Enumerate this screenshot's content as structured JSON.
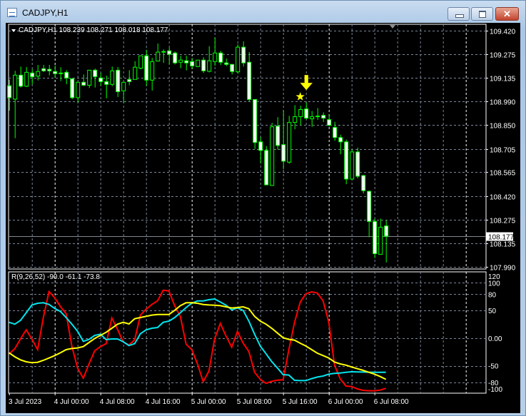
{
  "window": {
    "title": "CADJPY,H1",
    "buttons": {
      "minimize": "minimize",
      "maximize": "maximize",
      "close": "close"
    }
  },
  "colors": {
    "background": "#000000",
    "candle_outline": "#00ff00",
    "bear_body": "#ffffff",
    "bull_body": "#000000",
    "grid": "#7a8799",
    "day_separator": "#ffffff",
    "axis_text": "#ffffff",
    "price_line": "#808890",
    "marker": "#ffff00"
  },
  "chart_data": [
    {
      "type": "candlestick",
      "title": "CADJPY,H1",
      "info": "CADJPY,H1  108.239 108.271 108.018 108.177",
      "ohlc_order": [
        "open",
        "high",
        "low",
        "close"
      ],
      "candles": [
        [
          109.086,
          109.122,
          108.935,
          109.014
        ],
        [
          109.005,
          109.176,
          108.769,
          109.15
        ],
        [
          109.15,
          109.202,
          109.075,
          109.083
        ],
        [
          109.083,
          109.199,
          109.078,
          109.167
        ],
        [
          109.163,
          109.187,
          109.094,
          109.14
        ],
        [
          109.144,
          109.212,
          109.118,
          109.172
        ],
        [
          109.189,
          109.212,
          109.169,
          109.176
        ],
        [
          109.185,
          109.212,
          109.148,
          109.176
        ],
        [
          109.172,
          109.208,
          109.135,
          109.159
        ],
        [
          109.163,
          109.198,
          109.114,
          109.162
        ],
        [
          109.167,
          109.18,
          109.095,
          109.133
        ],
        [
          109.128,
          109.133,
          109.005,
          109.014
        ],
        [
          109.014,
          109.107,
          108.985,
          109.107
        ],
        [
          109.107,
          109.154,
          109.083,
          109.089
        ],
        [
          109.089,
          109.18,
          109.072,
          109.18
        ],
        [
          109.18,
          109.19,
          109.075,
          109.141
        ],
        [
          109.133,
          109.164,
          109.086,
          109.111
        ],
        [
          109.111,
          109.147,
          109.01,
          109.094
        ],
        [
          109.094,
          109.202,
          109.083,
          109.176
        ],
        [
          109.18,
          109.199,
          109.018,
          109.05
        ],
        [
          109.055,
          109.107,
          108.981,
          109.107
        ],
        [
          109.124,
          109.18,
          109.089,
          109.111
        ],
        [
          109.124,
          109.234,
          109.124,
          109.198
        ],
        [
          109.192,
          109.267,
          109.185,
          109.267
        ],
        [
          109.267,
          109.303,
          109.085,
          109.12
        ],
        [
          109.12,
          109.254,
          109.057,
          109.232
        ],
        [
          109.235,
          109.341,
          109.235,
          109.289
        ],
        [
          109.292,
          109.306,
          109.224,
          109.293
        ],
        [
          109.297,
          109.315,
          109.216,
          109.276
        ],
        [
          109.284,
          109.293,
          109.215,
          109.224
        ],
        [
          109.228,
          109.267,
          109.192,
          109.241
        ],
        [
          109.237,
          109.267,
          109.179,
          109.224
        ],
        [
          109.232,
          109.254,
          109.189,
          109.206
        ],
        [
          109.202,
          109.241,
          109.198,
          109.241
        ],
        [
          109.241,
          109.258,
          109.163,
          109.176
        ],
        [
          109.173,
          109.325,
          109.167,
          109.237
        ],
        [
          109.232,
          109.377,
          109.206,
          109.284
        ],
        [
          109.284,
          109.297,
          109.211,
          109.228
        ],
        [
          109.224,
          109.25,
          109.205,
          109.215
        ],
        [
          109.215,
          109.215,
          109.154,
          109.172
        ],
        [
          109.17,
          109.336,
          109.159,
          109.319
        ],
        [
          109.319,
          109.354,
          109.202,
          109.224
        ],
        [
          109.228,
          109.289,
          108.99,
          109.003
        ],
        [
          109.003,
          109.003,
          108.704,
          108.743
        ],
        [
          108.747,
          108.776,
          108.617,
          108.695
        ],
        [
          108.695,
          108.721,
          108.487,
          108.487
        ],
        [
          108.483,
          108.862,
          108.483,
          108.838
        ],
        [
          108.842,
          108.896,
          108.699,
          108.725
        ],
        [
          108.73,
          108.938,
          108.581,
          108.63
        ],
        [
          108.624,
          108.904,
          108.615,
          108.864
        ],
        [
          108.864,
          108.969,
          108.823,
          108.899
        ],
        [
          108.899,
          108.965,
          108.847,
          108.942
        ],
        [
          108.946,
          108.985,
          108.884,
          108.89
        ],
        [
          108.886,
          108.933,
          108.838,
          108.899
        ],
        [
          108.902,
          108.951,
          108.88,
          108.903
        ],
        [
          108.907,
          108.925,
          108.867,
          108.89
        ],
        [
          108.881,
          108.912,
          108.841,
          108.847
        ],
        [
          108.834,
          108.868,
          108.754,
          108.773
        ],
        [
          108.773,
          108.79,
          108.672,
          108.747
        ],
        [
          108.747,
          108.76,
          108.491,
          108.522
        ],
        [
          108.522,
          108.699,
          108.517,
          108.686
        ],
        [
          108.686,
          108.712,
          108.526,
          108.539
        ],
        [
          108.543,
          108.548,
          108.435,
          108.452
        ],
        [
          108.448,
          108.452,
          108.171,
          108.266
        ],
        [
          108.266,
          108.283,
          108.045,
          108.071
        ],
        [
          108.067,
          108.283,
          108.067,
          108.231
        ],
        [
          108.239,
          108.271,
          108.018,
          108.177
        ]
      ],
      "current_price": "108.177",
      "y_ticks": [
        "109.420",
        "109.275",
        "109.135",
        "108.990",
        "108.850",
        "108.705",
        "108.565",
        "108.420",
        "108.275",
        "108.135",
        "107.990"
      ],
      "ylim": [
        107.99,
        109.42
      ],
      "markers": [
        {
          "type": "star",
          "bar": 51,
          "price": 109.02
        },
        {
          "type": "arrow-down",
          "bar": 52,
          "price": 109.06
        }
      ],
      "grid": true
    },
    {
      "type": "line",
      "title": "R(9,26,52)",
      "readout": [
        "-90.0",
        "-61.1",
        "-73.8"
      ],
      "y_ticks": [
        "120",
        "100",
        "80",
        "50",
        "0.00",
        "-50",
        "-80",
        "-100"
      ],
      "ylim": [
        -100,
        112
      ],
      "grid": true,
      "series": [
        {
          "color": "#ff0000",
          "values": [
            -28.2,
            -18.8,
            -1.3,
            15.0,
            -1.3,
            -20.5,
            37.2,
            83.8,
            72.6,
            56.8,
            44.0,
            -14.1,
            -53.8,
            -71.8,
            -46.2,
            -22.6,
            -15.0,
            -9.8,
            36.3,
            15.8,
            -6.4,
            -12.0,
            -3.0,
            41.5,
            52.1,
            60.7,
            67.1,
            86.3,
            85.0,
            58.5,
            39.3,
            -10.7,
            -20.5,
            -46.2,
            -78.2,
            -59.0,
            -1.3,
            26.5,
            3.8,
            -16.2,
            12.4,
            -9.0,
            -23.9,
            -61.1,
            -73.9,
            -81.2,
            -77.4,
            -75.2,
            -74.8,
            -20.5,
            28.6,
            65.0,
            80.0,
            83.3,
            81.2,
            67.1,
            28.6,
            -48.3,
            -73.1,
            -85.9,
            -86.8,
            -91.0,
            -93.6,
            -94.4,
            -94.4,
            -93.2,
            -90.0
          ]
        },
        {
          "color": "#00e5ee",
          "values": [
            28.6,
            25.2,
            32.1,
            45.7,
            59.8,
            62.8,
            63.7,
            60.7,
            53.4,
            47.9,
            37.2,
            25.2,
            12.4,
            -5.6,
            -2.1,
            5.1,
            7.3,
            -2.6,
            -1.3,
            -1.3,
            -6.4,
            -13.2,
            -9.8,
            8.1,
            15.0,
            17.9,
            19.2,
            28.6,
            30.8,
            37.2,
            45.7,
            55.1,
            62.8,
            67.1,
            67.1,
            69.2,
            70.5,
            65.0,
            59.4,
            50.9,
            54.3,
            50.0,
            30.8,
            7.3,
            -14.1,
            -27.8,
            -41.9,
            -53.4,
            -65.4,
            -66.2,
            -75.6,
            -76.1,
            -76.1,
            -72.6,
            -69.7,
            -67.9,
            -64.5,
            -63.2,
            -62.4,
            -61.1,
            -60.3,
            -60.5,
            -60.8,
            -61.0,
            -61.1,
            -61.1,
            -61.1
          ]
        },
        {
          "color": "#ffff00",
          "values": [
            -26.1,
            -33.3,
            -38.9,
            -42.3,
            -44.0,
            -43.2,
            -39.7,
            -35.5,
            -31.2,
            -26.1,
            -20.5,
            -18.4,
            -17.5,
            -15.0,
            -7.7,
            -0.4,
            5.1,
            10.7,
            17.9,
            25.2,
            28.6,
            25.6,
            35.0,
            37.2,
            39.3,
            41.5,
            42.7,
            42.7,
            42.7,
            50.0,
            58.5,
            63.7,
            63.7,
            62.8,
            60.7,
            59.8,
            59.4,
            58.5,
            56.4,
            54.3,
            55.1,
            56.4,
            53.0,
            39.3,
            30.8,
            25.2,
            17.9,
            9.4,
            0.9,
            -2.1,
            -3.4,
            -9.0,
            -14.1,
            -20.5,
            -26.9,
            -31.2,
            -35.5,
            -42.7,
            -46.2,
            -48.3,
            -51.7,
            -54.7,
            -57.7,
            -61.1,
            -64.5,
            -68.8,
            -73.8
          ]
        }
      ]
    }
  ],
  "x_axis": {
    "labels": [
      "3 Jul 2023",
      "4 Jul 00:00",
      "4 Jul 08:00",
      "4 Jul 16:00",
      "5 Jul 00:00",
      "5 Jul 08:00",
      "5 Jul 16:00",
      "6 Jul 00:00",
      "6 Jul 08:00"
    ]
  }
}
